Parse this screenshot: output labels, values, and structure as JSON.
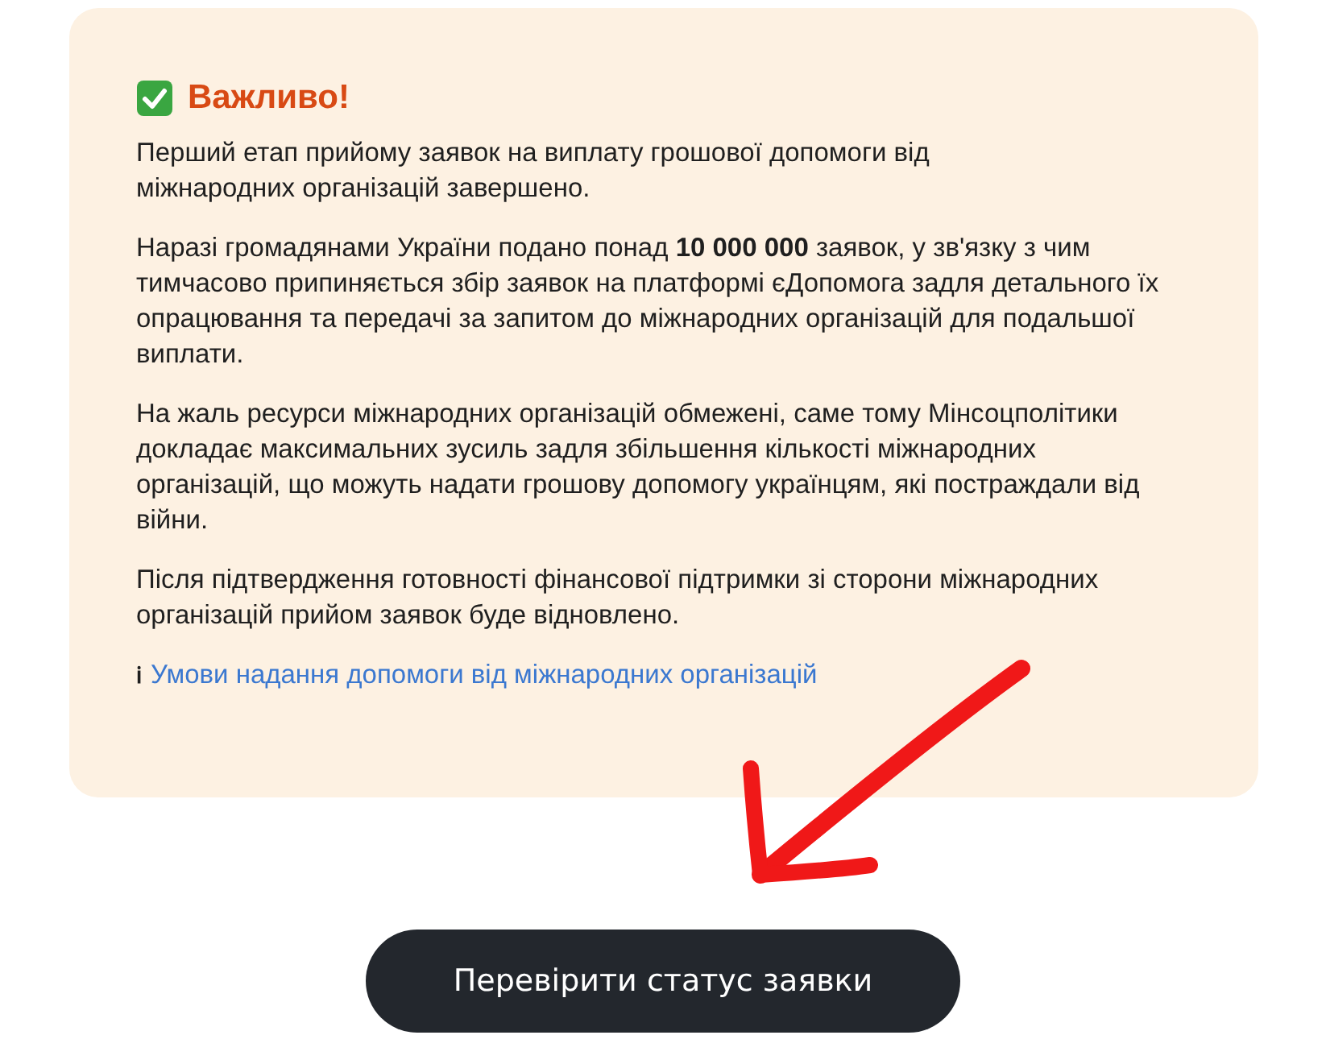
{
  "notice": {
    "title": "Важливо!",
    "paragraphs": [
      "Перший етап прийому заявок на виплату грошової допомоги від міжнародних організацій завершено.",
      "Наразі громадянами України подано понад **10 000 000** заявок, у зв'язку з чим тимчасово припиняється збір заявок на платформі єДопомога задля детального їх опрацювання та передачі за запитом до міжнародних організацій для подальшої виплати.",
      "На жаль ресурси міжнародних організацій обмежені, саме тому Мінсоцполітики докладає максимальних зусиль задля збільшення кількості міжнародних організацій, що можуть надати грошову допомогу українцям, які постраждали від війни.",
      "Після підтвердження готовності фінансової підтримки зі сторони міжнародних організацій прийом заявок буде відновлено."
    ],
    "info_mark": "ℹ",
    "link": "Умови надання допомоги від міжнародних організацій"
  },
  "button": "Перевірити статус заявки"
}
